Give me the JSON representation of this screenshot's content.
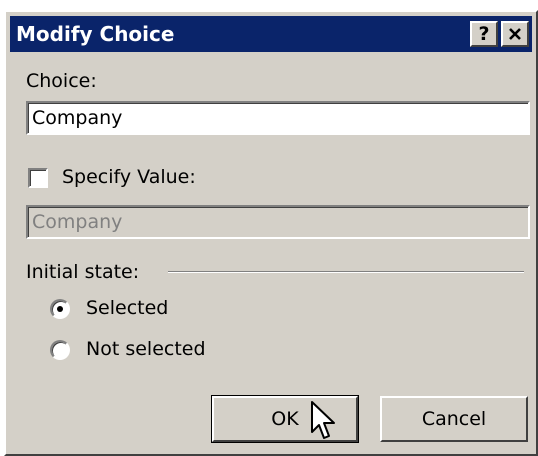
{
  "dialog": {
    "title": "Modify Choice",
    "help_button": "?",
    "close_button": "✕"
  },
  "choice": {
    "label": "Choice:",
    "value": "Company"
  },
  "specify_value": {
    "label": "Specify Value:",
    "checked": false,
    "value": "Company"
  },
  "initial_state": {
    "label": "Initial state:",
    "options": [
      {
        "label": "Selected",
        "selected": true
      },
      {
        "label": "Not selected",
        "selected": false
      }
    ]
  },
  "buttons": {
    "ok_label": "OK",
    "cancel_label": "Cancel"
  },
  "colors": {
    "titlebar": "#0a246a",
    "face": "#d4d0c8"
  }
}
